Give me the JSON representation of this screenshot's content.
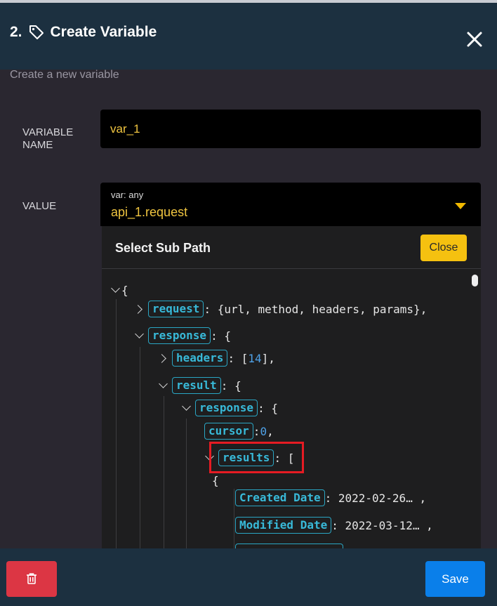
{
  "dialog": {
    "step": "2.",
    "title": "Create Variable",
    "subtitle": "Create a new variable"
  },
  "form": {
    "name_label": "VARIABLE NAME",
    "name_value": "var_1",
    "value_label": "VALUE",
    "value_type": "var: any",
    "value_selected": "api_1.request"
  },
  "subpath": {
    "title": "Select Sub Path",
    "close_label": "Close"
  },
  "tree": {
    "root_open": "{",
    "request_key": "request",
    "request_summary": ": {url, method, headers, params},",
    "response_key": "response",
    "response_open": ": {",
    "headers_key": "headers",
    "headers_sep": ": [",
    "headers_count": "14",
    "headers_close": "],",
    "result_key": "result",
    "result_open": ": {",
    "inner_response_key": "response",
    "inner_response_open": ": {",
    "cursor_key": "cursor",
    "cursor_sep": ": ",
    "cursor_value": "0",
    "cursor_comma": ",",
    "results_key": "results",
    "results_open": ": [",
    "item_open": "{",
    "created_key": "Created Date",
    "created_value": ": 2022-02-26… ,",
    "modified_key": "Modified Date",
    "modified_value": ": 2022-03-12… ,"
  },
  "footer": {
    "save_label": "Save"
  },
  "icons": {
    "title": "tag-icon",
    "close": "close-icon",
    "caret": "caret-down-icon",
    "delete": "trash-icon"
  },
  "colors": {
    "header_bg": "#1c3040",
    "body_bg": "#2a2730",
    "accent_yellow": "#f5c110",
    "key_cyan": "#38b9d8",
    "delete_red": "#dc3644",
    "save_blue": "#0a7fea",
    "highlight_red": "#e51b23"
  }
}
